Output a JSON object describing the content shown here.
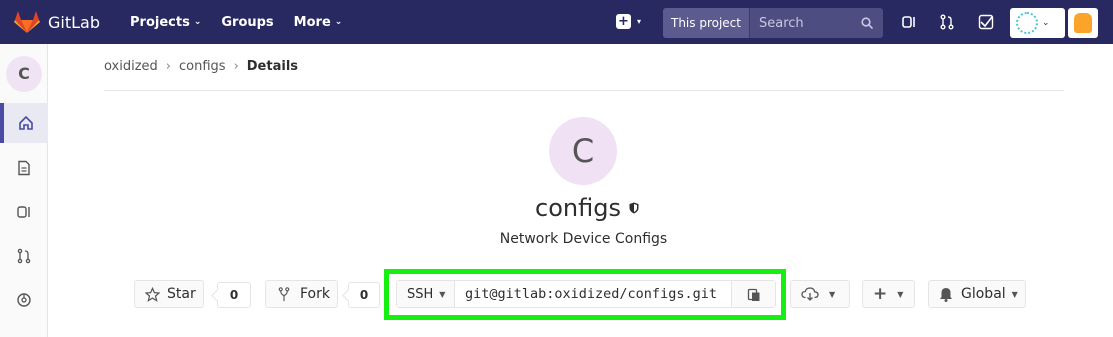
{
  "topbar": {
    "brand": "GitLab",
    "nav": [
      {
        "label": "Projects",
        "dropdown": true
      },
      {
        "label": "Groups",
        "dropdown": false
      },
      {
        "label": "More",
        "dropdown": true
      }
    ],
    "search_scope": "This project",
    "search_placeholder": "Search",
    "icons": [
      "plus-icon",
      "issues-icon",
      "merge-request-icon",
      "todo-icon",
      "user-avatar",
      "user-icon"
    ]
  },
  "sidebar": {
    "project_initial": "C",
    "items": [
      "home-icon",
      "repository-icon",
      "issues-icon",
      "merge-requests-icon",
      "ci-cd-icon"
    ]
  },
  "breadcrumb": {
    "items": [
      "oxidized",
      "configs"
    ],
    "current": "Details"
  },
  "project": {
    "initial": "C",
    "name": "configs",
    "description": "Network Device Configs"
  },
  "actions": {
    "star_label": "Star",
    "star_count": "0",
    "fork_label": "Fork",
    "fork_count": "0",
    "clone_protocol": "SSH",
    "clone_url": "git@gitlab:oxidized/configs.git",
    "notification_label": "Global"
  },
  "colors": {
    "topbar": "#292961",
    "highlight": "#16f011",
    "avatar_bg": "#f1e1f5"
  }
}
